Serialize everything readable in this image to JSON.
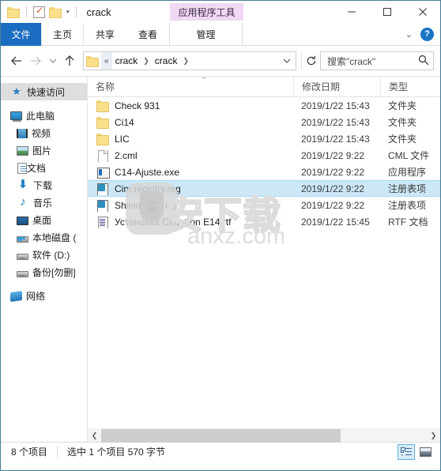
{
  "window": {
    "title": "crack",
    "contextual_tab_title": "应用程序工具",
    "minimize_label": "最小化",
    "maximize_label": "最大化",
    "close_label": "关闭",
    "quick_access": {
      "folder_icon": "folder-icon",
      "properties_icon": "properties-icon",
      "new_folder_icon": "new-folder-icon",
      "customize_caret": "▾"
    }
  },
  "ribbon": {
    "tabs": [
      {
        "label": "文件",
        "name": "tab-file",
        "style": "file"
      },
      {
        "label": "主页",
        "name": "tab-home",
        "style": "boxed"
      },
      {
        "label": "共享",
        "name": "tab-share",
        "style": "plain"
      },
      {
        "label": "查看",
        "name": "tab-view",
        "style": "plain"
      },
      {
        "label": "管理",
        "name": "tab-manage",
        "style": "ctx"
      }
    ],
    "expand_caret": "⌄",
    "help_label": "?"
  },
  "address_bar": {
    "back_label": "←",
    "forward_label": "→",
    "recent_caret": "⌄",
    "up_label": "↑",
    "folder_icon": "folder-icon",
    "overflow_chevrons": "«",
    "breadcrumbs": [
      "crack",
      "crack"
    ],
    "breadcrumb_separator": "❯",
    "dropdown_caret": "⌄",
    "refresh_label": "↻",
    "search_placeholder": "搜索\"crack\"",
    "search_value": "",
    "search_icon": "search-icon"
  },
  "nav_pane": {
    "items": [
      {
        "label": "快速访问",
        "icon": "ic-star",
        "name": "sidebar-item-quick-access",
        "indent": "lvl0",
        "selected": true,
        "gap_before": false
      },
      {
        "label": "此电脑",
        "icon": "ic-pc",
        "name": "sidebar-item-this-pc",
        "indent": "lvl0",
        "selected": false,
        "gap_before": true
      },
      {
        "label": "视频",
        "icon": "ic-video",
        "name": "sidebar-item-videos",
        "indent": "lvl1",
        "selected": false,
        "gap_before": false
      },
      {
        "label": "图片",
        "icon": "ic-pic",
        "name": "sidebar-item-pictures",
        "indent": "lvl1",
        "selected": false,
        "gap_before": false
      },
      {
        "label": "文档",
        "icon": "ic-doc",
        "name": "sidebar-item-documents",
        "indent": "lvl1",
        "selected": false,
        "gap_before": false
      },
      {
        "label": "下载",
        "icon": "ic-down",
        "name": "sidebar-item-downloads",
        "indent": "lvl1",
        "selected": false,
        "gap_before": false
      },
      {
        "label": "音乐",
        "icon": "ic-music",
        "name": "sidebar-item-music",
        "indent": "lvl1",
        "selected": false,
        "gap_before": false
      },
      {
        "label": "桌面",
        "icon": "ic-desktop",
        "name": "sidebar-item-desktop",
        "indent": "lvl1",
        "selected": false,
        "gap_before": false
      },
      {
        "label": "本地磁盘 (",
        "icon": "ic-drive-sys",
        "name": "sidebar-item-local-disk",
        "indent": "lvl1",
        "selected": false,
        "gap_before": false
      },
      {
        "label": "软件 (D:)",
        "icon": "ic-drive",
        "name": "sidebar-item-software-d",
        "indent": "lvl1",
        "selected": false,
        "gap_before": false
      },
      {
        "label": "备份[勿删]",
        "icon": "ic-drive",
        "name": "sidebar-item-backup",
        "indent": "lvl1",
        "selected": false,
        "gap_before": false
      },
      {
        "label": "网络",
        "icon": "ic-net",
        "name": "sidebar-item-network",
        "indent": "lvl0",
        "selected": false,
        "gap_before": true
      }
    ]
  },
  "file_list": {
    "columns": [
      {
        "key": "name",
        "label": "名称"
      },
      {
        "key": "date",
        "label": "修改日期"
      },
      {
        "key": "type",
        "label": "类型"
      }
    ],
    "sort_column": "名称",
    "sort_arrow": "⌃",
    "rows": [
      {
        "name": "Check 931",
        "date": "2019/1/22 15:43",
        "type": "文件夹",
        "icon": "fi-folder",
        "selected": false
      },
      {
        "name": "Ci14",
        "date": "2019/1/22 15:43",
        "type": "文件夹",
        "icon": "fi-folder",
        "selected": false
      },
      {
        "name": "LIC",
        "date": "2019/1/22 15:43",
        "type": "文件夹",
        "icon": "fi-folder",
        "selected": false
      },
      {
        "name": "2.cml",
        "date": "2019/1/22 9:22",
        "type": "CML 文件",
        "icon": "fi-blank",
        "selected": false
      },
      {
        "name": "C14-Ajuste.exe",
        "date": "2019/1/22 9:22",
        "type": "应用程序",
        "icon": "fi-exe",
        "selected": false
      },
      {
        "name": "Cim registry.reg",
        "date": "2019/1/22 9:22",
        "type": "注册表项",
        "icon": "fi-reg",
        "selected": true
      },
      {
        "name": "Shield 931.reg",
        "date": "2019/1/22 9:22",
        "type": "注册表项",
        "icon": "fi-reg",
        "selected": false
      },
      {
        "name": "Установка Cimatron E14.rtf",
        "date": "2019/1/22 15:45",
        "type": "RTF 文档",
        "icon": "fi-rtf",
        "selected": false
      }
    ]
  },
  "watermark": {
    "badge_glyph": "安",
    "chinese_text": "安下载",
    "url_text": "anxz.com"
  },
  "scrollbar": {
    "left_arrow": "❮",
    "right_arrow": "❯"
  },
  "status_bar": {
    "item_count": "8 个项目",
    "selection_info": "选中 1 个项目  570 字节",
    "view_details_label": "详细信息",
    "view_large_label": "大图标"
  },
  "colors": {
    "window_border": "#4a7c94",
    "file_tab": "#1a6dc0",
    "contextual_tab": "#f0d9f3",
    "selection": "#cce8f7",
    "selection_border": "#a8d8f0",
    "nav_selected": "#dedede",
    "accent": "#1a73c4"
  }
}
